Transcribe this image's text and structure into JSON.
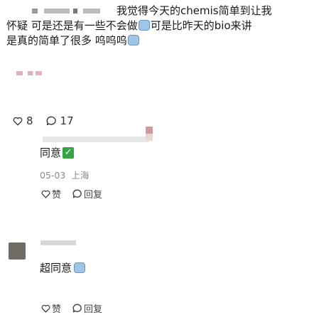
{
  "post": {
    "text_line1": "我觉得今天的chemis简单到让我",
    "text_line2_a": "怀疑 可是还是有一些不会做",
    "text_line2_b": "可是比昨天的bio来讲",
    "text_line3": "是真的简单了很多 呜呜呜",
    "like_count": "8",
    "comment_count": "17"
  },
  "comments": [
    {
      "text": "同意",
      "date": "05-03",
      "location": "上海",
      "like_label": "赞",
      "reply_label": "回复"
    },
    {
      "text": "超同意",
      "like_label": "赞",
      "reply_label": "回复"
    }
  ],
  "icons": {
    "like": "heart-outline-icon",
    "comment": "chat-bubble-icon",
    "check": "green-check-icon",
    "emoji": "sweat-face-emoji"
  },
  "colors": {
    "check_green": "#35a246",
    "meta_gray": "#8a8a8a"
  }
}
